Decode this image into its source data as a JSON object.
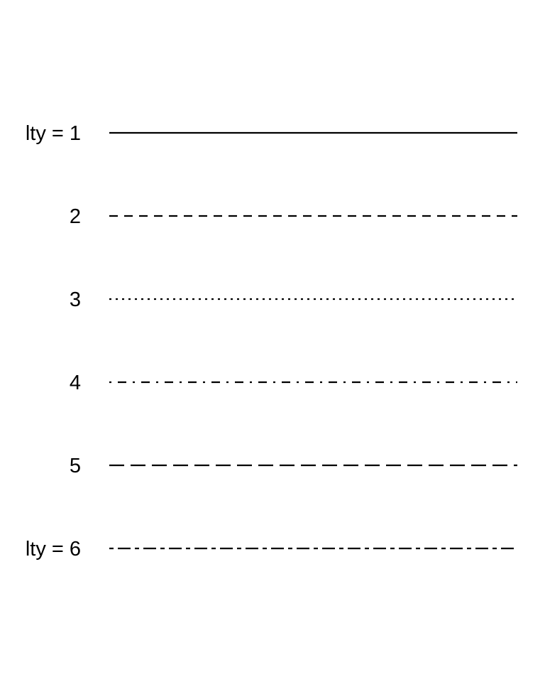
{
  "figure": {
    "type": "line-type-demo",
    "background": "#ffffff",
    "line_color": "#000000",
    "rows": [
      {
        "label": "lty = 1",
        "lty": 1,
        "style": "solid"
      },
      {
        "label": "2",
        "lty": 2,
        "style": "dashed"
      },
      {
        "label": "3",
        "lty": 3,
        "style": "dotted"
      },
      {
        "label": "4",
        "lty": 4,
        "style": "dotdash"
      },
      {
        "label": "5",
        "lty": 5,
        "style": "longdash"
      },
      {
        "label": "lty = 6",
        "lty": 6,
        "style": "twodash"
      }
    ]
  }
}
